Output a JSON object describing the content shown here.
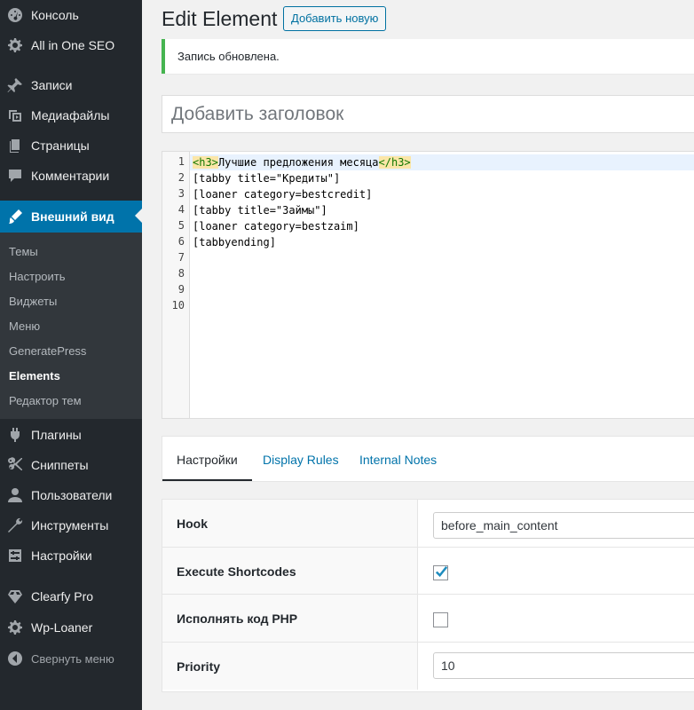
{
  "sidebar": {
    "top_items": [
      {
        "label": "Консоль",
        "icon": "dashboard-icon"
      },
      {
        "label": "All in One SEO",
        "icon": "gear-icon"
      },
      {
        "label": "Записи",
        "icon": "pin-icon"
      },
      {
        "label": "Медиафайлы",
        "icon": "media-icon"
      },
      {
        "label": "Страницы",
        "icon": "pages-icon"
      },
      {
        "label": "Комментарии",
        "icon": "comment-icon"
      },
      {
        "label": "Внешний вид",
        "icon": "brush-icon"
      }
    ],
    "submenu": [
      "Темы",
      "Настроить",
      "Виджеты",
      "Меню",
      "GeneratePress",
      "Elements",
      "Редактор тем"
    ],
    "bottom_items": [
      {
        "label": "Плагины",
        "icon": "plugin-icon"
      },
      {
        "label": "Сниппеты",
        "icon": "scissors-icon"
      },
      {
        "label": "Пользователи",
        "icon": "user-icon"
      },
      {
        "label": "Инструменты",
        "icon": "wrench-icon"
      },
      {
        "label": "Настройки",
        "icon": "settings-icon"
      },
      {
        "label": "Clearfy Pro",
        "icon": "diamond-icon"
      },
      {
        "label": "Wp-Loaner",
        "icon": "gear-icon"
      },
      {
        "label": "Свернуть меню",
        "icon": "collapse-icon"
      }
    ]
  },
  "header": {
    "title": "Edit Element",
    "add_new_label": "Добавить новую"
  },
  "notice": {
    "text": "Запись обновлена."
  },
  "title_input": {
    "placeholder": "Добавить заголовок",
    "value": ""
  },
  "editor": {
    "line_numbers": [
      "1",
      "2",
      "3",
      "4",
      "5",
      "6",
      "7",
      "8",
      "9",
      "10"
    ],
    "line1": {
      "open_tag": "<h3>",
      "text": "Лучшие предложения месяца",
      "close_tag": "</h3>"
    },
    "lines": [
      "[tabby title=\"Кредиты\"]",
      "[loaner category=bestcredit]",
      "[tabby title=\"Займы\"]",
      "[loaner category=bestzaim]",
      "[tabbyending]"
    ]
  },
  "tabs": [
    "Настройки",
    "Display Rules",
    "Internal Notes"
  ],
  "settings": {
    "hook_label": "Hook",
    "hook_value": "before_main_content",
    "shortcodes_label": "Execute Shortcodes",
    "shortcodes_checked": true,
    "php_label": "Исполнять код PHP",
    "php_checked": false,
    "priority_label": "Priority",
    "priority_value": "10"
  },
  "colors": {
    "sidebar_bg": "#23282d",
    "active_bg": "#0073aa",
    "notice_border": "#46b450",
    "link": "#0073aa"
  }
}
